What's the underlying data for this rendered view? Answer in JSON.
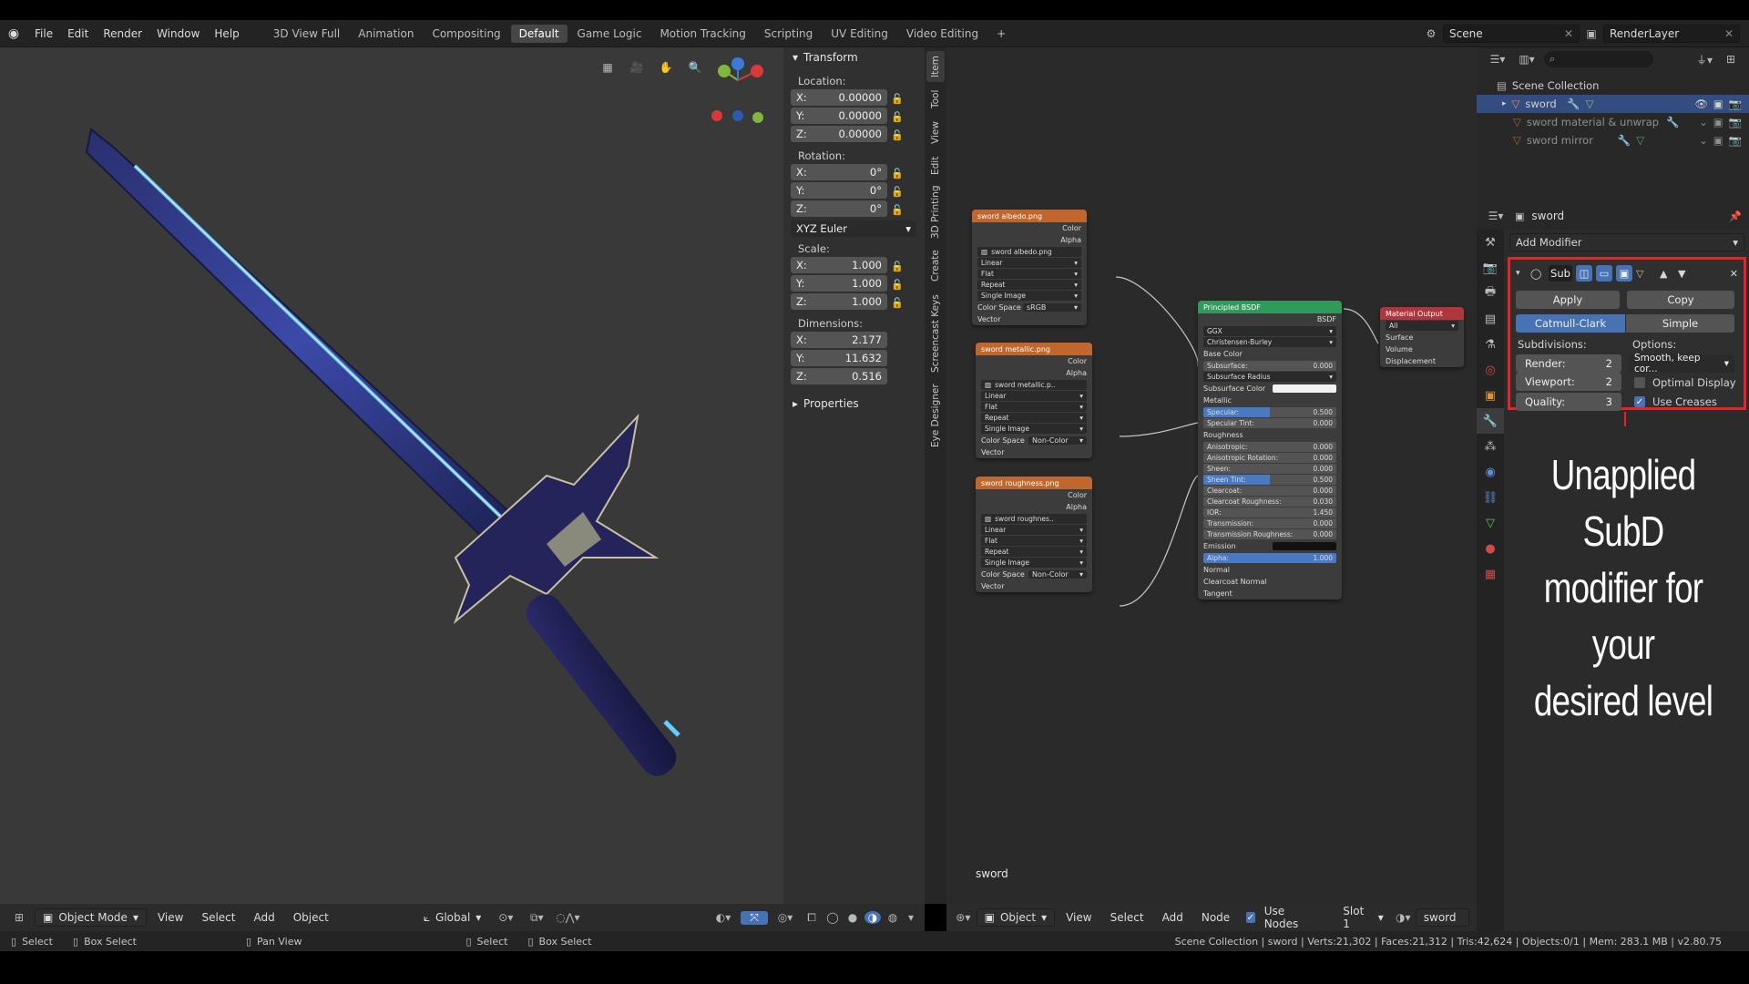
{
  "topbar": {
    "menus": [
      "File",
      "Edit",
      "Render",
      "Window",
      "Help"
    ],
    "workspaces": [
      "3D View Full",
      "Animation",
      "Compositing",
      "Default",
      "Game Logic",
      "Motion Tracking",
      "Scripting",
      "UV Editing",
      "Video Editing"
    ],
    "active_workspace": "Default",
    "scene": "Scene",
    "render_layer": "RenderLayer"
  },
  "viewport": {
    "mode": "Object Mode",
    "menus": [
      "View",
      "Select",
      "Add",
      "Object"
    ],
    "orientation": "Global"
  },
  "npanel": {
    "section_transform": "Transform",
    "location_label": "Location:",
    "location": [
      {
        "axis": "X:",
        "value": "0.00000"
      },
      {
        "axis": "Y:",
        "value": "0.00000"
      },
      {
        "axis": "Z:",
        "value": "0.00000"
      }
    ],
    "rotation_label": "Rotation:",
    "rotation": [
      {
        "axis": "X:",
        "value": "0°"
      },
      {
        "axis": "Y:",
        "value": "0°"
      },
      {
        "axis": "Z:",
        "value": "0°"
      }
    ],
    "rotation_mode": "XYZ Euler",
    "scale_label": "Scale:",
    "scale": [
      {
        "axis": "X:",
        "value": "1.000"
      },
      {
        "axis": "Y:",
        "value": "1.000"
      },
      {
        "axis": "Z:",
        "value": "1.000"
      }
    ],
    "dimensions_label": "Dimensions:",
    "dimensions": [
      {
        "axis": "X:",
        "value": "2.177"
      },
      {
        "axis": "Y:",
        "value": "11.632"
      },
      {
        "axis": "Z:",
        "value": "0.516"
      }
    ],
    "section_properties": "Properties"
  },
  "side_tabs": [
    "Item",
    "Tool",
    "View",
    "Edit",
    "3D Printing",
    "Create",
    "Screencast Keys",
    "Eye Designer"
  ],
  "node_editor": {
    "footer_label": "sword",
    "header": {
      "type": "Object",
      "menus": [
        "View",
        "Select",
        "Add",
        "Node"
      ],
      "use_nodes": "Use Nodes",
      "slot": "Slot 1",
      "material": "sword"
    },
    "tex_nodes": [
      {
        "title": "sword albedo.png",
        "image": "sword albedo.png",
        "interp": "Linear",
        "proj": "Flat",
        "ext": "Repeat",
        "source": "Single Image",
        "color_space": "sRGB"
      },
      {
        "title": "sword metallic.png",
        "image": "sword metallic.p..",
        "interp": "Linear",
        "proj": "Flat",
        "ext": "Repeat",
        "source": "Single Image",
        "color_space": "Non-Color"
      },
      {
        "title": "sword roughness.png",
        "image": "sword roughnes..",
        "interp": "Linear",
        "proj": "Flat",
        "ext": "Repeat",
        "source": "Single Image",
        "color_space": "Non-Color"
      }
    ],
    "tex_labels": {
      "color": "Color",
      "alpha": "Alpha",
      "color_space": "Color Space",
      "vector": "Vector"
    },
    "bsdf": {
      "title": "Principled BSDF",
      "out": "BSDF",
      "distribution": "GGX",
      "subsurface_method": "Christensen-Burley",
      "rows": [
        {
          "label": "Base Color",
          "kind": "label"
        },
        {
          "label": "Subsurface:",
          "value": "0.000",
          "kind": "slider"
        },
        {
          "label": "Subsurface Radius",
          "kind": "select"
        },
        {
          "label": "Subsurface Color",
          "kind": "color"
        },
        {
          "label": "Metallic",
          "kind": "label"
        },
        {
          "label": "Specular:",
          "value": "0.500",
          "kind": "blue"
        },
        {
          "label": "Specular Tint:",
          "value": "0.000",
          "kind": "slider"
        },
        {
          "label": "Roughness",
          "kind": "label"
        },
        {
          "label": "Anisotropic:",
          "value": "0.000",
          "kind": "slider"
        },
        {
          "label": "Anisotropic Rotation:",
          "value": "0.000",
          "kind": "slider"
        },
        {
          "label": "Sheen:",
          "value": "0.000",
          "kind": "slider"
        },
        {
          "label": "Sheen Tint:",
          "value": "0.500",
          "kind": "blue"
        },
        {
          "label": "Clearcoat:",
          "value": "0.000",
          "kind": "slider"
        },
        {
          "label": "Clearcoat Roughness:",
          "value": "0.030",
          "kind": "slider"
        },
        {
          "label": "IOR:",
          "value": "1.450",
          "kind": "slider"
        },
        {
          "label": "Transmission:",
          "value": "0.000",
          "kind": "slider"
        },
        {
          "label": "Transmission Roughness:",
          "value": "0.000",
          "kind": "slider"
        },
        {
          "label": "Emission",
          "kind": "black"
        },
        {
          "label": "Alpha:",
          "value": "1.000",
          "kind": "full"
        },
        {
          "label": "Normal",
          "kind": "label"
        },
        {
          "label": "Clearcoat Normal",
          "kind": "label"
        },
        {
          "label": "Tangent",
          "kind": "label"
        }
      ]
    },
    "output": {
      "title": "Material Output",
      "target": "All",
      "inputs": [
        "Surface",
        "Volume",
        "Displacement"
      ]
    }
  },
  "outliner": {
    "collection": "Scene Collection",
    "items": [
      "sword",
      "sword material & unwrap",
      "sword mirror"
    ]
  },
  "properties": {
    "object_name": "sword",
    "add_modifier": "Add Modifier",
    "modifier_name": "Sub",
    "apply": "Apply",
    "copy": "Copy",
    "catmull": "Catmull-Clark",
    "simple": "Simple",
    "subdivisions_label": "Subdivisions:",
    "options_label": "Options:",
    "render_label": "Render:",
    "render_value": "2",
    "viewport_label": "Viewport:",
    "viewport_value": "2",
    "quality_label": "Quality:",
    "quality_value": "3",
    "uv_smooth": "Smooth, keep cor...",
    "optimal_display": "Optimal Display",
    "use_creases": "Use Creases"
  },
  "overlay_caption": [
    "Unapplied SubD",
    "modifier for your",
    "desired level"
  ],
  "statusbar": {
    "left": [
      {
        "key": "Select"
      },
      {
        "key": "Box Select"
      },
      {
        "key": "Pan View"
      },
      {
        "key": "Select"
      },
      {
        "key": "Box Select"
      }
    ],
    "right": "Scene Collection | sword | Verts:21,302 | Faces:21,312 | Tris:42,624 | Objects:0/1 | Mem: 283.1 MB | v2.80.75"
  },
  "colors": {
    "accent": "#4772b3",
    "highlight_red": "#e0262a",
    "tex_header": "#c1662c",
    "bsdf_header": "#2f9a59",
    "out_header": "#b2353b"
  }
}
